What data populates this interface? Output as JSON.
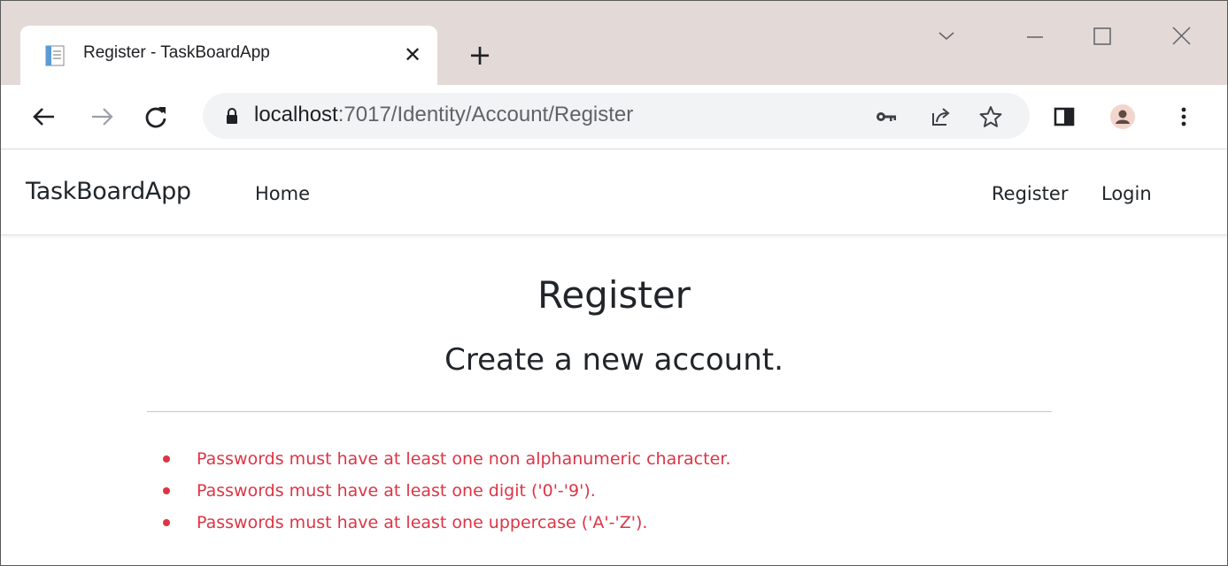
{
  "browser": {
    "tab": {
      "title": "Register - TaskBoardApp",
      "close_glyph": "✕"
    },
    "new_tab_glyph": "+",
    "address": {
      "host": "localhost",
      "path": ":7017/Identity/Account/Register"
    },
    "icons": [
      "tab-search-icon",
      "minimize-icon",
      "maximize-icon",
      "close-window-icon",
      "back-icon",
      "forward-icon",
      "reload-icon",
      "lock-icon",
      "key-icon",
      "share-icon",
      "star-icon",
      "sidepanel-icon",
      "profile-icon",
      "menu-icon"
    ]
  },
  "navbar": {
    "brand": "TaskBoardApp",
    "home": "Home",
    "register": "Register",
    "login": "Login"
  },
  "main": {
    "title": "Register",
    "subtitle": "Create a new account.",
    "errors": [
      "Passwords must have at least one non alphanumeric character.",
      "Passwords must have at least one digit ('0'-'9').",
      "Passwords must have at least one uppercase ('A'-'Z')."
    ]
  },
  "colors": {
    "error": "#dc3545",
    "tabstrip": "#e3d9d6",
    "text": "#212529"
  }
}
